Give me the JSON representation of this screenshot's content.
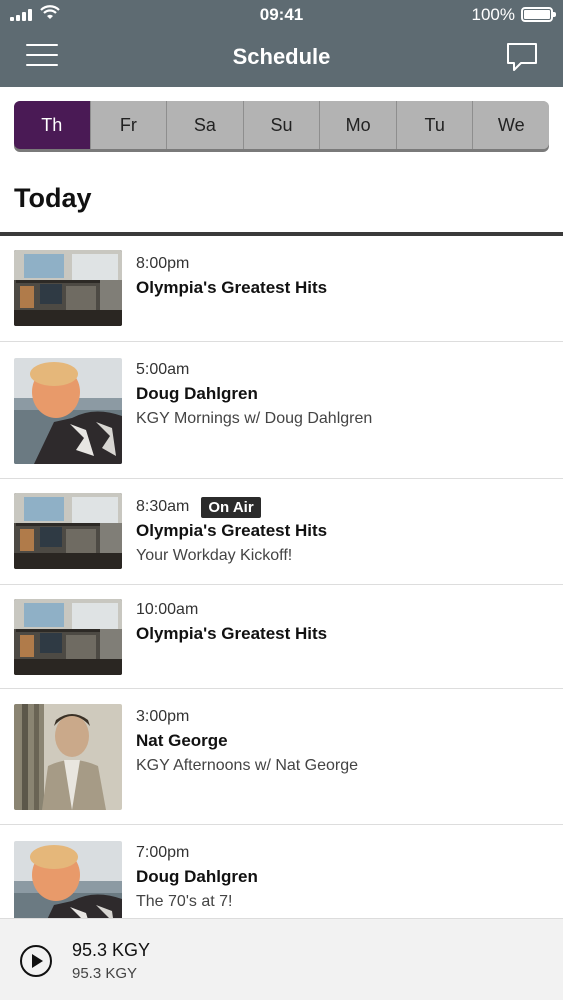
{
  "status_bar": {
    "time": "09:41",
    "battery": "100%"
  },
  "header": {
    "title": "Schedule"
  },
  "icons": {
    "menu": "hamburger-menu-icon",
    "chat": "chat-bubble-icon",
    "play": "play-icon"
  },
  "colors": {
    "header_bg": "#5e6b72",
    "active_tab": "#4a1a55",
    "tab_bg": "#b3b3b3"
  },
  "days": [
    {
      "label": "Th",
      "active": true
    },
    {
      "label": "Fr"
    },
    {
      "label": "Sa"
    },
    {
      "label": "Su"
    },
    {
      "label": "Mo"
    },
    {
      "label": "Tu"
    },
    {
      "label": "We"
    }
  ],
  "section_title": "Today",
  "schedule": [
    {
      "time": "8:00pm",
      "show": "Olympia's Greatest Hits",
      "subtitle": "",
      "on_air": "",
      "image": "studio-photo"
    },
    {
      "time": "5:00am",
      "show": "Doug Dahlgren",
      "subtitle": "KGY Mornings w/ Doug Dahlgren",
      "on_air": "",
      "image": "host-photo-doug"
    },
    {
      "time": "8:30am",
      "show": "Olympia's Greatest Hits",
      "subtitle": "Your Workday Kickoff!",
      "on_air": "On Air",
      "image": "studio-photo"
    },
    {
      "time": "10:00am",
      "show": "Olympia's Greatest Hits",
      "subtitle": "",
      "on_air": "",
      "image": "studio-photo"
    },
    {
      "time": "3:00pm",
      "show": "Nat George",
      "subtitle": "KGY Afternoons w/ Nat George",
      "on_air": "",
      "image": "host-photo-nat"
    },
    {
      "time": "7:00pm",
      "show": "Doug Dahlgren",
      "subtitle": "The 70's at 7!",
      "on_air": "",
      "image": "host-photo-doug"
    }
  ],
  "player": {
    "station": "95.3 KGY",
    "subtitle": "95.3 KGY"
  }
}
